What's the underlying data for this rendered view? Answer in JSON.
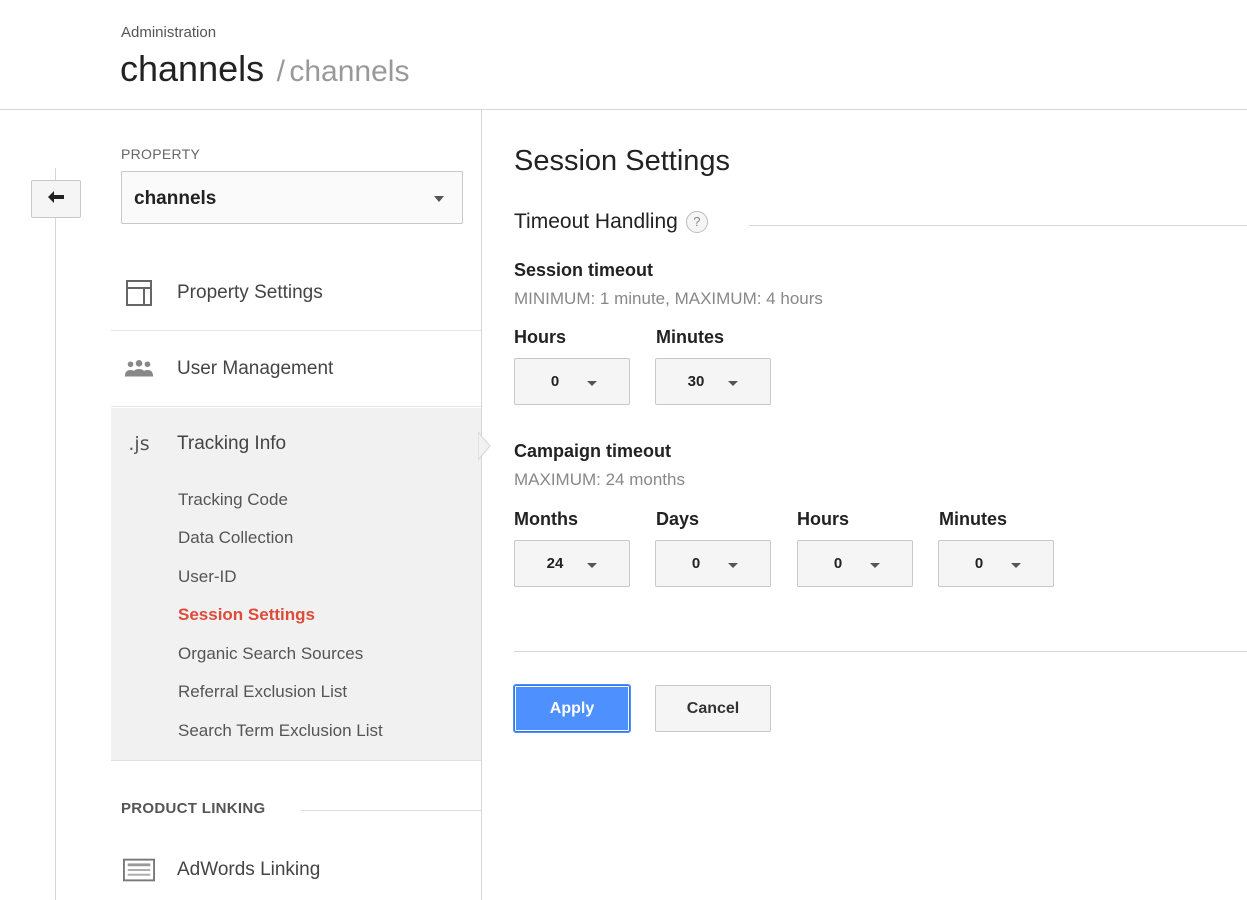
{
  "header": {
    "breadcrumb": "Administration",
    "title": "channels",
    "separator": "/",
    "subtitle": "channels"
  },
  "sidebar": {
    "property_label": "PROPERTY",
    "property_value": "channels",
    "items": [
      {
        "label": "Property Settings",
        "icon": "property-settings-icon"
      },
      {
        "label": "User Management",
        "icon": "users-icon"
      },
      {
        "label": "Tracking Info",
        "icon": "js-icon",
        "icon_text": ".js"
      }
    ],
    "tracking_subitems": [
      "Tracking Code",
      "Data Collection",
      "User-ID",
      "Session Settings",
      "Organic Search Sources",
      "Referral Exclusion List",
      "Search Term Exclusion List"
    ],
    "active_subitem": "Session Settings",
    "product_linking_label": "PRODUCT LINKING",
    "adwords_label": "AdWords Linking"
  },
  "main": {
    "title": "Session Settings",
    "section": "Timeout Handling",
    "help_glyph": "?",
    "session_timeout": {
      "title": "Session timeout",
      "hint": "MINIMUM: 1 minute, MAXIMUM: 4 hours",
      "hours_label": "Hours",
      "hours_value": "0",
      "minutes_label": "Minutes",
      "minutes_value": "30"
    },
    "campaign_timeout": {
      "title": "Campaign timeout",
      "hint": "MAXIMUM: 24 months",
      "months_label": "Months",
      "months_value": "24",
      "days_label": "Days",
      "days_value": "0",
      "hours_label": "Hours",
      "hours_value": "0",
      "minutes_label": "Minutes",
      "minutes_value": "0"
    },
    "apply_label": "Apply",
    "cancel_label": "Cancel"
  },
  "colors": {
    "active_link": "#dd4b39",
    "primary_button": "#4d90fe"
  }
}
